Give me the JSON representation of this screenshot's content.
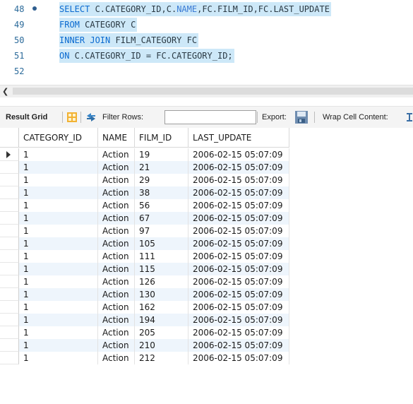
{
  "editor": {
    "lines": [
      {
        "num": "48",
        "parts": [
          [
            "kw",
            "SELECT"
          ],
          [
            "tx",
            " C.CATEGORY_ID,C."
          ],
          [
            "nm",
            "NAME"
          ],
          [
            "tx",
            ",FC.FILM_ID,FC.LAST_UPDATE"
          ]
        ],
        "highlighted": true,
        "dot": true
      },
      {
        "num": "49",
        "parts": [
          [
            "kw",
            "FROM"
          ],
          [
            "tx",
            " CATEGORY C"
          ]
        ],
        "highlighted": true,
        "dot": false
      },
      {
        "num": "50",
        "parts": [
          [
            "kw",
            "INNER JOIN"
          ],
          [
            "tx",
            " FILM_CATEGORY FC"
          ]
        ],
        "highlighted": true,
        "dot": false
      },
      {
        "num": "51",
        "parts": [
          [
            "kw",
            "ON"
          ],
          [
            "tx",
            " C.CATEGORY_ID = FC.CATEGORY_ID;"
          ]
        ],
        "highlighted": true,
        "dot": false
      },
      {
        "num": "52",
        "parts": [],
        "highlighted": false,
        "dot": false
      }
    ]
  },
  "toolbar": {
    "result_grid_label": "Result Grid",
    "filter_rows_label": "Filter Rows:",
    "filter_value": "",
    "export_label": "Export:",
    "wrap_label": "Wrap Cell Content:"
  },
  "grid": {
    "columns": [
      "CATEGORY_ID",
      "NAME",
      "FILM_ID",
      "LAST_UPDATE"
    ],
    "rows": [
      [
        "1",
        "Action",
        "19",
        "2006-02-15 05:07:09"
      ],
      [
        "1",
        "Action",
        "21",
        "2006-02-15 05:07:09"
      ],
      [
        "1",
        "Action",
        "29",
        "2006-02-15 05:07:09"
      ],
      [
        "1",
        "Action",
        "38",
        "2006-02-15 05:07:09"
      ],
      [
        "1",
        "Action",
        "56",
        "2006-02-15 05:07:09"
      ],
      [
        "1",
        "Action",
        "67",
        "2006-02-15 05:07:09"
      ],
      [
        "1",
        "Action",
        "97",
        "2006-02-15 05:07:09"
      ],
      [
        "1",
        "Action",
        "105",
        "2006-02-15 05:07:09"
      ],
      [
        "1",
        "Action",
        "111",
        "2006-02-15 05:07:09"
      ],
      [
        "1",
        "Action",
        "115",
        "2006-02-15 05:07:09"
      ],
      [
        "1",
        "Action",
        "126",
        "2006-02-15 05:07:09"
      ],
      [
        "1",
        "Action",
        "130",
        "2006-02-15 05:07:09"
      ],
      [
        "1",
        "Action",
        "162",
        "2006-02-15 05:07:09"
      ],
      [
        "1",
        "Action",
        "194",
        "2006-02-15 05:07:09"
      ],
      [
        "1",
        "Action",
        "205",
        "2006-02-15 05:07:09"
      ],
      [
        "1",
        "Action",
        "210",
        "2006-02-15 05:07:09"
      ],
      [
        "1",
        "Action",
        "212",
        "2006-02-15 05:07:09"
      ]
    ],
    "current_row_index": 0
  },
  "colors": {
    "selection": "#cde8f8",
    "keyword": "#0a6ad0",
    "alt_row": "#eef5fc"
  }
}
